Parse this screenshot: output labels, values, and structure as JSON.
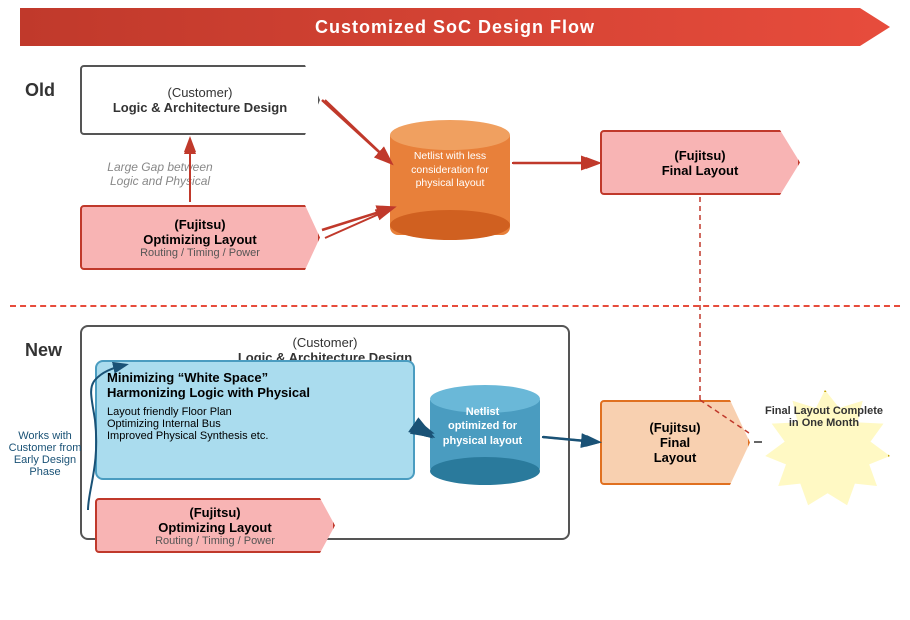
{
  "banner": {
    "title": "Customized SoC Design Flow"
  },
  "sections": {
    "old_label": "Old",
    "new_label": "New"
  },
  "old": {
    "customer_box": {
      "line1": "(Customer)",
      "line2": "Logic & Architecture Design"
    },
    "fujitsu_box": {
      "line1": "(Fujitsu)",
      "line2": "Optimizing Layout",
      "line3": "Routing / Timing / Power"
    },
    "netlist_cylinder": {
      "line1": "Netlist with less",
      "line2": "consideration for",
      "line3": "physical layout"
    },
    "final_layout": {
      "line1": "(Fujitsu)",
      "line2": "Final Layout"
    },
    "gap_text": {
      "line1": "Large Gap between",
      "line2": "Logic and Physical"
    }
  },
  "new": {
    "customer_box": {
      "line1": "(Customer)",
      "line2": "Logic & Architecture Design"
    },
    "inner_blue": {
      "title1": "Minimizing “White Space”",
      "title2": "Harmonizing Logic with Physical",
      "bullet1": "Layout friendly Floor Plan",
      "bullet2": "Optimizing Internal Bus",
      "bullet3": "Improved  Physical Synthesis etc."
    },
    "fujitsu_box": {
      "line1": "(Fujitsu)",
      "line2": "Optimizing Layout",
      "line3": "Routing / Timing / Power"
    },
    "netlist_cylinder": {
      "line1": "Netlist",
      "line2": "optimized for",
      "line3": "physical layout"
    },
    "final_layout": {
      "line1": "(Fujitsu)",
      "line2": "Final",
      "line3": "Layout"
    },
    "starburst": {
      "line1": "Final Layout Complete",
      "line2": "in One Month"
    },
    "works_text": {
      "line1": "Works with",
      "line2": "Customer from",
      "line3": "Early Design Phase"
    }
  }
}
